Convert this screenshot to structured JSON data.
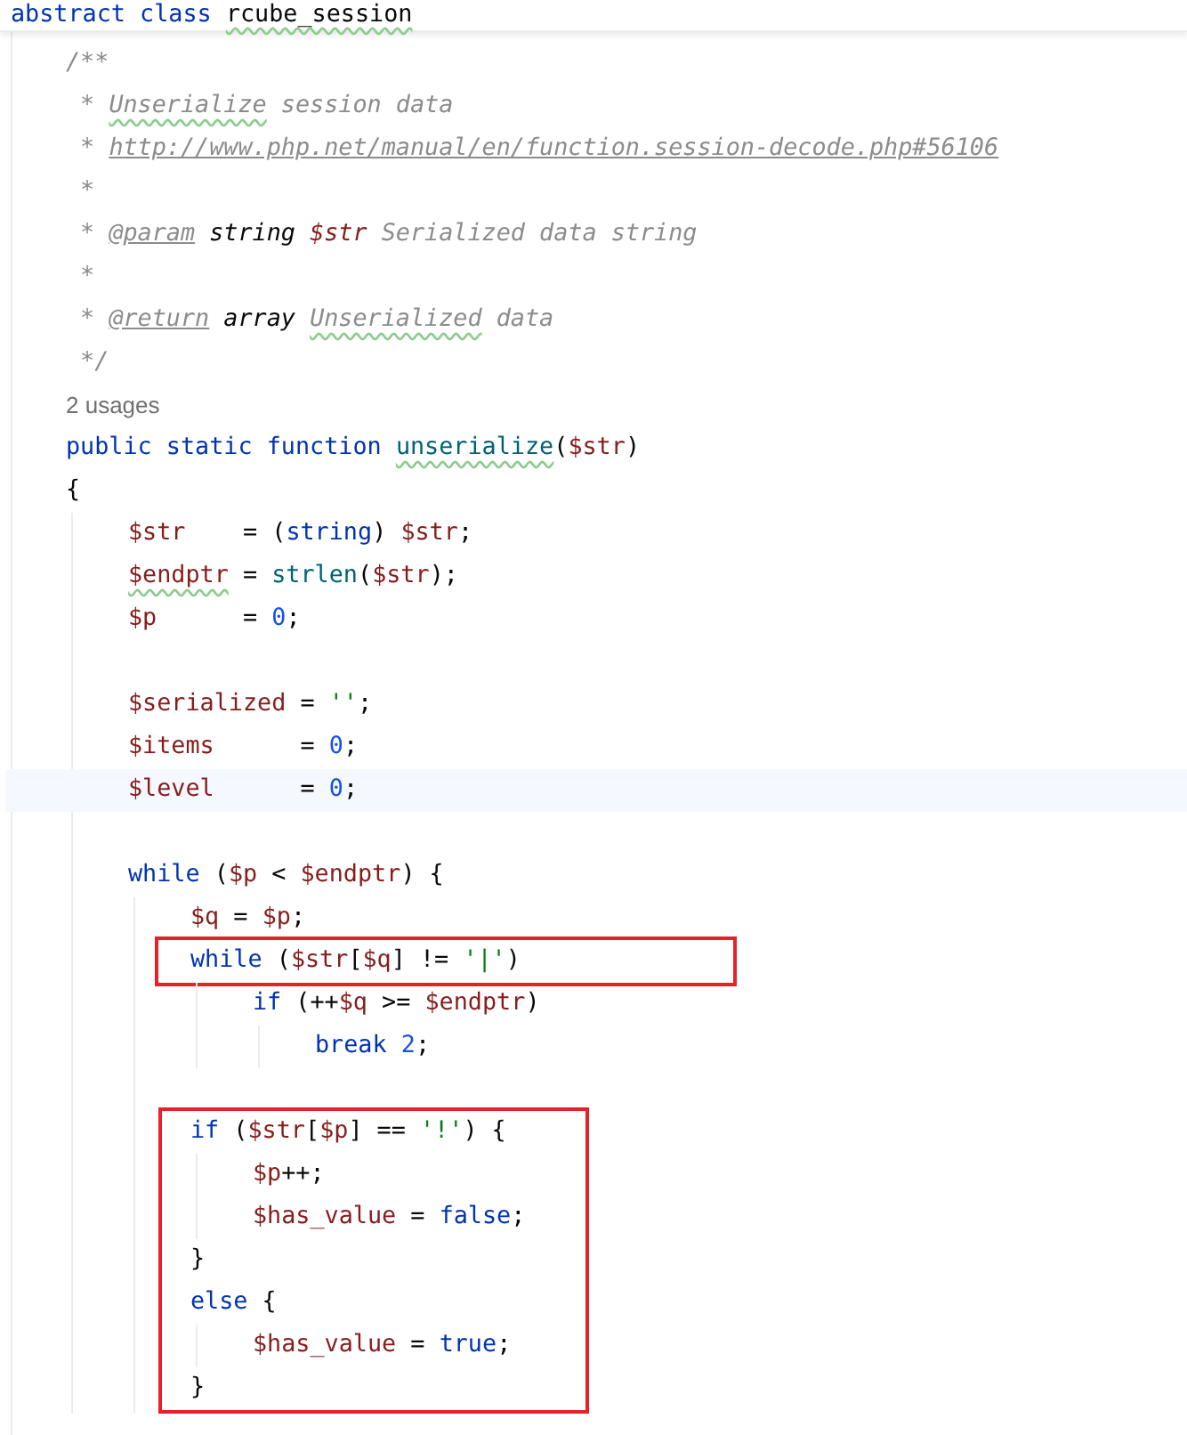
{
  "header": {
    "tokens": [
      {
        "kind": "keyword",
        "text": "abstract class "
      },
      {
        "kind": "plain",
        "text": "rcube_session",
        "spell": true
      }
    ]
  },
  "code": {
    "lines": [
      {
        "kind": "code",
        "tokens": [
          {
            "kind": "comment",
            "text": "/**"
          }
        ]
      },
      {
        "kind": "code",
        "tokens": [
          {
            "kind": "comment",
            "text": " * "
          },
          {
            "kind": "comment",
            "text": "Unserialize",
            "spell": true
          },
          {
            "kind": "comment",
            "text": " session data"
          }
        ]
      },
      {
        "kind": "code",
        "tokens": [
          {
            "kind": "comment",
            "text": " * "
          },
          {
            "kind": "link",
            "text": "http://www.php.net/manual/en/function.session-decode.php#56106"
          }
        ]
      },
      {
        "kind": "code",
        "tokens": [
          {
            "kind": "comment",
            "text": " *"
          }
        ]
      },
      {
        "kind": "code",
        "tokens": [
          {
            "kind": "comment",
            "text": " * "
          },
          {
            "kind": "doc_tag",
            "text": "@param"
          },
          {
            "kind": "doc_type",
            "text": " string "
          },
          {
            "kind": "doc_var",
            "text": "$str"
          },
          {
            "kind": "comment",
            "text": " Serialized data string"
          }
        ]
      },
      {
        "kind": "code",
        "tokens": [
          {
            "kind": "comment",
            "text": " *"
          }
        ]
      },
      {
        "kind": "code",
        "tokens": [
          {
            "kind": "comment",
            "text": " * "
          },
          {
            "kind": "doc_tag",
            "text": "@return"
          },
          {
            "kind": "doc_type",
            "text": " array "
          },
          {
            "kind": "comment",
            "text": "Unserialized",
            "spell": true
          },
          {
            "kind": "comment",
            "text": " data"
          }
        ]
      },
      {
        "kind": "code",
        "tokens": [
          {
            "kind": "comment",
            "text": " */"
          }
        ]
      },
      {
        "kind": "inlay",
        "text": "2 usages"
      },
      {
        "kind": "code",
        "tokens": [
          {
            "kind": "keyword",
            "text": "public static function "
          },
          {
            "kind": "function",
            "text": "unserialize",
            "spell": true
          },
          {
            "kind": "plain",
            "text": "("
          },
          {
            "kind": "var",
            "text": "$str"
          },
          {
            "kind": "plain",
            "text": ")"
          }
        ]
      },
      {
        "kind": "code",
        "tokens": [
          {
            "kind": "plain",
            "text": "{"
          }
        ],
        "children": [
          {
            "kind": "code",
            "tokens": [
              {
                "kind": "var",
                "text": "$str"
              },
              {
                "kind": "plain",
                "text": "    = ("
              },
              {
                "kind": "keyword",
                "text": "string"
              },
              {
                "kind": "plain",
                "text": ") "
              },
              {
                "kind": "var",
                "text": "$str"
              },
              {
                "kind": "plain",
                "text": ";"
              }
            ]
          },
          {
            "kind": "code",
            "tokens": [
              {
                "kind": "var",
                "text": "$endptr",
                "spell": true
              },
              {
                "kind": "plain",
                "text": " = "
              },
              {
                "kind": "function",
                "text": "strlen"
              },
              {
                "kind": "plain",
                "text": "("
              },
              {
                "kind": "var",
                "text": "$str"
              },
              {
                "kind": "plain",
                "text": ");"
              }
            ]
          },
          {
            "kind": "code",
            "tokens": [
              {
                "kind": "var",
                "text": "$p"
              },
              {
                "kind": "plain",
                "text": "      = "
              },
              {
                "kind": "number",
                "text": "0"
              },
              {
                "kind": "plain",
                "text": ";"
              }
            ]
          },
          {
            "kind": "blank"
          },
          {
            "kind": "code",
            "tokens": [
              {
                "kind": "var",
                "text": "$serialized"
              },
              {
                "kind": "plain",
                "text": " = "
              },
              {
                "kind": "string",
                "text": "''"
              },
              {
                "kind": "plain",
                "text": ";"
              }
            ]
          },
          {
            "kind": "code",
            "tokens": [
              {
                "kind": "var",
                "text": "$items"
              },
              {
                "kind": "plain",
                "text": "      = "
              },
              {
                "kind": "number",
                "text": "0"
              },
              {
                "kind": "plain",
                "text": ";"
              }
            ]
          },
          {
            "kind": "code",
            "current": true,
            "tokens": [
              {
                "kind": "var",
                "text": "$level"
              },
              {
                "kind": "plain",
                "text": "      = "
              },
              {
                "kind": "number",
                "text": "0"
              },
              {
                "kind": "plain",
                "text": ";"
              }
            ]
          },
          {
            "kind": "blank"
          },
          {
            "kind": "code",
            "tokens": [
              {
                "kind": "keyword",
                "text": "while"
              },
              {
                "kind": "plain",
                "text": " ("
              },
              {
                "kind": "var",
                "text": "$p"
              },
              {
                "kind": "plain",
                "text": " < "
              },
              {
                "kind": "var",
                "text": "$endptr"
              },
              {
                "kind": "plain",
                "text": ") {"
              }
            ],
            "children": [
              {
                "kind": "code",
                "tokens": [
                  {
                    "kind": "var",
                    "text": "$q"
                  },
                  {
                    "kind": "plain",
                    "text": " = "
                  },
                  {
                    "kind": "var",
                    "text": "$p"
                  },
                  {
                    "kind": "plain",
                    "text": ";"
                  }
                ]
              },
              {
                "kind": "code",
                "marked": true,
                "tokens": [
                  {
                    "kind": "keyword",
                    "text": "while"
                  },
                  {
                    "kind": "plain",
                    "text": " ("
                  },
                  {
                    "kind": "var",
                    "text": "$str"
                  },
                  {
                    "kind": "plain",
                    "text": "["
                  },
                  {
                    "kind": "var",
                    "text": "$q"
                  },
                  {
                    "kind": "plain",
                    "text": "] != "
                  },
                  {
                    "kind": "string",
                    "text": "'|'"
                  },
                  {
                    "kind": "plain",
                    "text": ")"
                  }
                ],
                "children": [
                  {
                    "kind": "code",
                    "tokens": [
                      {
                        "kind": "keyword",
                        "text": "if"
                      },
                      {
                        "kind": "plain",
                        "text": " (++"
                      },
                      {
                        "kind": "var",
                        "text": "$q"
                      },
                      {
                        "kind": "plain",
                        "text": " >= "
                      },
                      {
                        "kind": "var",
                        "text": "$endptr"
                      },
                      {
                        "kind": "plain",
                        "text": ")"
                      }
                    ],
                    "children": [
                      {
                        "kind": "code",
                        "tokens": [
                          {
                            "kind": "keyword",
                            "text": "break "
                          },
                          {
                            "kind": "number",
                            "text": "2"
                          },
                          {
                            "kind": "plain",
                            "text": ";"
                          }
                        ]
                      }
                    ]
                  }
                ]
              },
              {
                "kind": "blank"
              },
              {
                "kind": "group",
                "marked": true,
                "lines": [
                  {
                    "kind": "code",
                    "tokens": [
                      {
                        "kind": "keyword",
                        "text": "if"
                      },
                      {
                        "kind": "plain",
                        "text": " ("
                      },
                      {
                        "kind": "var",
                        "text": "$str"
                      },
                      {
                        "kind": "plain",
                        "text": "["
                      },
                      {
                        "kind": "var",
                        "text": "$p"
                      },
                      {
                        "kind": "plain",
                        "text": "] == "
                      },
                      {
                        "kind": "string",
                        "text": "'!'"
                      },
                      {
                        "kind": "plain",
                        "text": ") {"
                      }
                    ],
                    "children": [
                      {
                        "kind": "code",
                        "tokens": [
                          {
                            "kind": "var",
                            "text": "$p"
                          },
                          {
                            "kind": "plain",
                            "text": "++;"
                          }
                        ]
                      },
                      {
                        "kind": "code",
                        "tokens": [
                          {
                            "kind": "var",
                            "text": "$has_value"
                          },
                          {
                            "kind": "plain",
                            "text": " = "
                          },
                          {
                            "kind": "keyword",
                            "text": "false"
                          },
                          {
                            "kind": "plain",
                            "text": ";"
                          }
                        ]
                      }
                    ]
                  },
                  {
                    "kind": "code",
                    "tokens": [
                      {
                        "kind": "plain",
                        "text": "}"
                      }
                    ]
                  },
                  {
                    "kind": "code",
                    "tokens": [
                      {
                        "kind": "keyword",
                        "text": "else"
                      },
                      {
                        "kind": "plain",
                        "text": " {"
                      }
                    ],
                    "children": [
                      {
                        "kind": "code",
                        "tokens": [
                          {
                            "kind": "var",
                            "text": "$has_value"
                          },
                          {
                            "kind": "plain",
                            "text": " = "
                          },
                          {
                            "kind": "keyword",
                            "text": "true"
                          },
                          {
                            "kind": "plain",
                            "text": ";"
                          }
                        ]
                      }
                    ]
                  },
                  {
                    "kind": "code",
                    "tokens": [
                      {
                        "kind": "plain",
                        "text": "}"
                      }
                    ]
                  }
                ]
              }
            ]
          }
        ]
      }
    ]
  }
}
